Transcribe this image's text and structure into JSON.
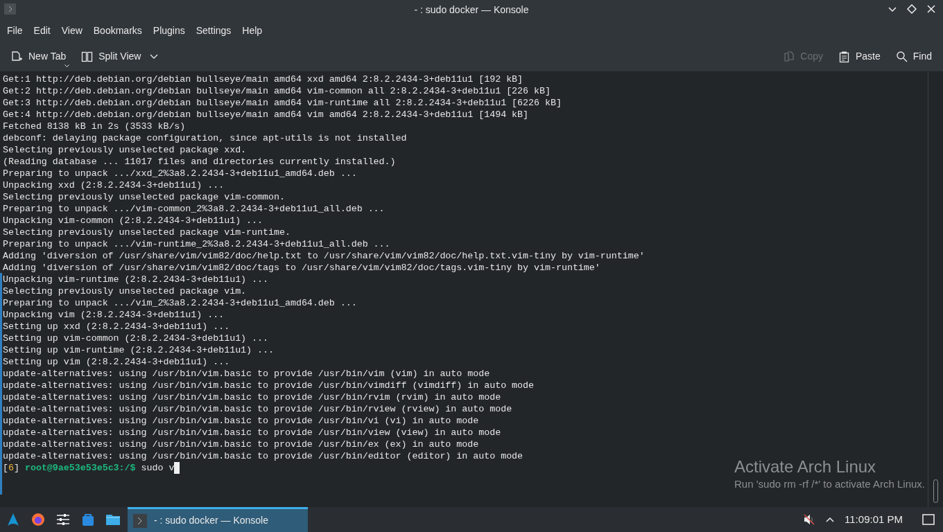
{
  "window": {
    "title": "- : sudo docker — Konsole"
  },
  "menu": [
    "File",
    "Edit",
    "View",
    "Bookmarks",
    "Plugins",
    "Settings",
    "Help"
  ],
  "toolbar_left": [
    {
      "kind": "new-tab",
      "label": "New Tab",
      "disabled": false
    },
    {
      "kind": "split-view",
      "label": "Split View",
      "disabled": false
    }
  ],
  "toolbar_right": [
    {
      "kind": "copy",
      "label": "Copy",
      "disabled": true
    },
    {
      "kind": "paste",
      "label": "Paste",
      "disabled": false
    },
    {
      "kind": "find",
      "label": "Find",
      "disabled": false
    }
  ],
  "terminal": {
    "lines": [
      "Get:1 http://deb.debian.org/debian bullseye/main amd64 xxd amd64 2:8.2.2434-3+deb11u1 [192 kB]",
      "Get:2 http://deb.debian.org/debian bullseye/main amd64 vim-common all 2:8.2.2434-3+deb11u1 [226 kB]",
      "Get:3 http://deb.debian.org/debian bullseye/main amd64 vim-runtime all 2:8.2.2434-3+deb11u1 [6226 kB]",
      "Get:4 http://deb.debian.org/debian bullseye/main amd64 vim amd64 2:8.2.2434-3+deb11u1 [1494 kB]",
      "Fetched 8138 kB in 2s (3533 kB/s)",
      "debconf: delaying package configuration, since apt-utils is not installed",
      "Selecting previously unselected package xxd.",
      "(Reading database ... 11017 files and directories currently installed.)",
      "Preparing to unpack .../xxd_2%3a8.2.2434-3+deb11u1_amd64.deb ...",
      "Unpacking xxd (2:8.2.2434-3+deb11u1) ...",
      "Selecting previously unselected package vim-common.",
      "Preparing to unpack .../vim-common_2%3a8.2.2434-3+deb11u1_all.deb ...",
      "Unpacking vim-common (2:8.2.2434-3+deb11u1) ...",
      "Selecting previously unselected package vim-runtime.",
      "Preparing to unpack .../vim-runtime_2%3a8.2.2434-3+deb11u1_all.deb ...",
      "Adding 'diversion of /usr/share/vim/vim82/doc/help.txt to /usr/share/vim/vim82/doc/help.txt.vim-tiny by vim-runtime'",
      "Adding 'diversion of /usr/share/vim/vim82/doc/tags to /usr/share/vim/vim82/doc/tags.vim-tiny by vim-runtime'",
      "Unpacking vim-runtime (2:8.2.2434-3+deb11u1) ...",
      "Selecting previously unselected package vim.",
      "Preparing to unpack .../vim_2%3a8.2.2434-3+deb11u1_amd64.deb ...",
      "Unpacking vim (2:8.2.2434-3+deb11u1) ...",
      "Setting up xxd (2:8.2.2434-3+deb11u1) ...",
      "Setting up vim-common (2:8.2.2434-3+deb11u1) ...",
      "Setting up vim-runtime (2:8.2.2434-3+deb11u1) ...",
      "Setting up vim (2:8.2.2434-3+deb11u1) ...",
      "update-alternatives: using /usr/bin/vim.basic to provide /usr/bin/vim (vim) in auto mode",
      "update-alternatives: using /usr/bin/vim.basic to provide /usr/bin/vimdiff (vimdiff) in auto mode",
      "update-alternatives: using /usr/bin/vim.basic to provide /usr/bin/rvim (rvim) in auto mode",
      "update-alternatives: using /usr/bin/vim.basic to provide /usr/bin/rview (rview) in auto mode",
      "update-alternatives: using /usr/bin/vim.basic to provide /usr/bin/vi (vi) in auto mode",
      "update-alternatives: using /usr/bin/vim.basic to provide /usr/bin/view (view) in auto mode",
      "update-alternatives: using /usr/bin/vim.basic to provide /usr/bin/ex (ex) in auto mode",
      "update-alternatives: using /usr/bin/vim.basic to provide /usr/bin/editor (editor) in auto mode"
    ],
    "prompt": {
      "job_open": "[",
      "job": "6",
      "job_close": "]",
      "user_host": "root@9ae53e53e5c3:/$",
      "command": "sudo v"
    }
  },
  "activation_notice": {
    "title": "Activate Arch Linux",
    "message": "Run 'sudo rm -rf /*' to activate Arch Linux."
  },
  "taskbar": {
    "launchers": [
      {
        "kind": "arch"
      },
      {
        "kind": "firefox"
      },
      {
        "kind": "settings"
      },
      {
        "kind": "store"
      },
      {
        "kind": "files"
      }
    ],
    "tasks": [
      {
        "label": "- : sudo docker — Konsole",
        "selected": true
      }
    ],
    "clock": "11:09:01 PM"
  }
}
